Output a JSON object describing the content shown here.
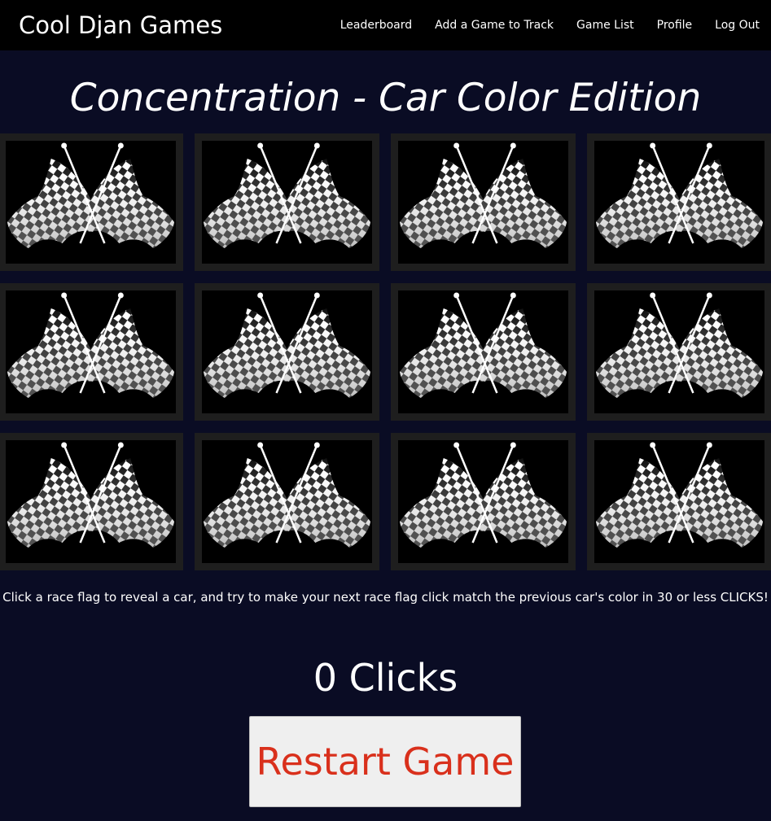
{
  "navbar": {
    "brand": "Cool Djan Games",
    "links": [
      "Leaderboard",
      "Add a Game to Track",
      "Game List",
      "Profile",
      "Log Out"
    ]
  },
  "game": {
    "title": "Concentration - Car Color Edition",
    "card_count": 12,
    "card_face": "checkered-flags-icon",
    "instructions": "Click a race flag to reveal a car, and try to make your next race flag click match the previous car's color in 30 or less CLICKS!",
    "clicks_text": "0 Clicks",
    "restart_label": "Restart Game"
  },
  "colors": {
    "page_background": "#0a0c24",
    "navbar_background": "#000000",
    "card_frame": "#1e1e1e",
    "restart_text": "#d9301c",
    "restart_background": "#efefef"
  }
}
